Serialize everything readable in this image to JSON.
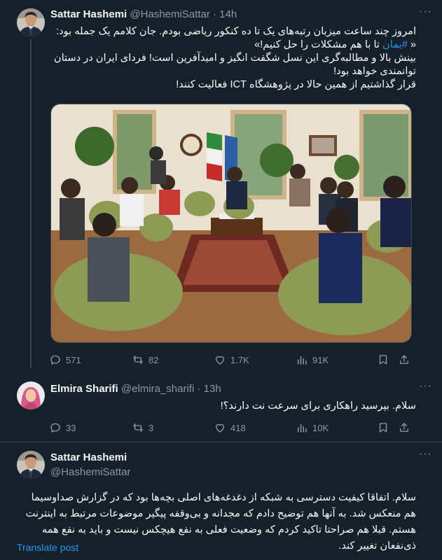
{
  "tweets": [
    {
      "name": "Sattar Hashemi",
      "handle": "@HashemiSattar",
      "time": "· 14h",
      "lines": [
        "امروز چند ساعت میزبان رتبه‌های یک تا ده کنکور ریاضی بودم. جان کلامم یک جمله بود:",
        "بینش بالا و مطالبه‌گری این نسل شگفت انگیز و امیدآفرین است! فردای ایران در دستان توانمندی خواهد بود!",
        "قرار گذاشتیم از همین حالا در پژوهشگاه ICT فعالیت کنند!"
      ],
      "quote_prefix": "« ",
      "hashtag": "#یمان",
      "quote_rest": " تا با هم مشکلات را حل کنیم!»",
      "replies": "571",
      "reposts": "82",
      "likes": "1.7K",
      "views": "91K"
    },
    {
      "name": "Elmira Sharifi",
      "handle": "@elmira_sharifi",
      "time": "· 13h",
      "text": "سلام. بپرسید راهکاری برای سرعت نت دارند؟!",
      "replies": "33",
      "reposts": "3",
      "likes": "418",
      "views": "10K"
    },
    {
      "name": "Sattar Hashemi",
      "handle": "@HashemiSattar",
      "text": "سلام. اتفاقا کیفیت دسترسی به شبکه از دغدغه‌های اصلی بچه‌ها بود که در گزارش صداوسیما هم منعکس شد. به آنها هم توضیح دادم که مجدانه و بی‌وقفه پیگیر موضوعات مرتبط به اینترنت هستم. قبلا هم صراحتا تاکید کردم که وضعیت فعلی به نفع هیچکس نیست و باید به نفع همه ذی‌نفعان تغییر کند.",
      "translate": "Translate post"
    }
  ],
  "colors": {
    "background": "#15202b",
    "text": "#f7f9f9",
    "muted": "#8b98a5",
    "accent": "#1d9bf0",
    "border": "#38444d"
  },
  "icons": [
    "reply-icon",
    "repost-icon",
    "like-icon",
    "views-icon",
    "bookmark-icon",
    "share-icon",
    "more-icon"
  ]
}
